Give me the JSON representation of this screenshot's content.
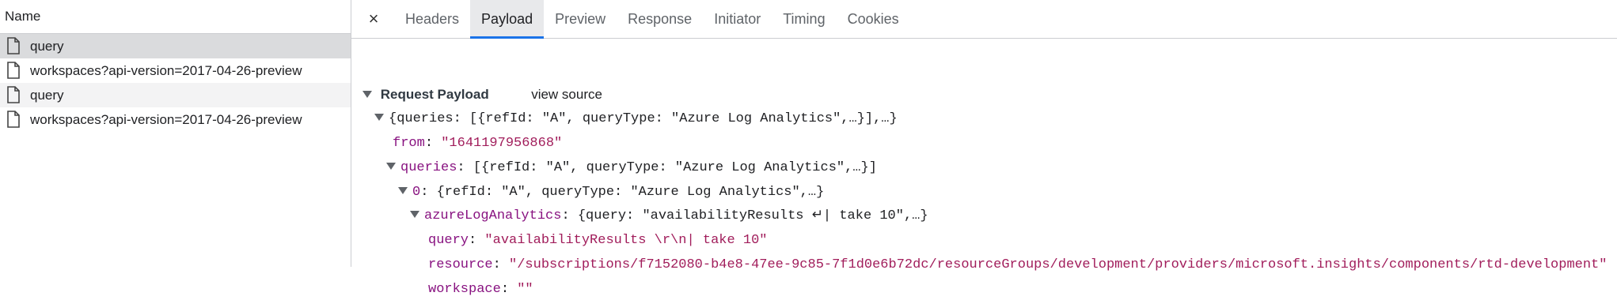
{
  "left_panel": {
    "header": "Name",
    "requests": [
      {
        "name": "query"
      },
      {
        "name": "workspaces?api-version=2017-04-26-preview"
      },
      {
        "name": "query"
      },
      {
        "name": "workspaces?api-version=2017-04-26-preview"
      }
    ]
  },
  "tabs": {
    "close_symbol": "×",
    "items": [
      "Headers",
      "Payload",
      "Preview",
      "Response",
      "Initiator",
      "Timing",
      "Cookies"
    ],
    "active": "Payload"
  },
  "payload": {
    "section_title": "Request Payload",
    "view_source": "view source",
    "root_summary": "{queries: [{refId: \"A\", queryType: \"Azure Log Analytics\",…}],…}",
    "from_key": "from",
    "from_value": "\"1641197956868\"",
    "queries_key": "queries",
    "queries_summary": "[{refId: \"A\", queryType: \"Azure Log Analytics\",…}]",
    "item0_key": "0",
    "item0_summary": "{refId: \"A\", queryType: \"Azure Log Analytics\",…}",
    "ala_key": "azureLogAnalytics",
    "ala_summary": "{query: \"availabilityResults ↵| take 10\",…}",
    "query_key": "query",
    "query_value": "\"availabilityResults \\r\\n| take 10\"",
    "resource_key": "resource",
    "resource_value": "\"/subscriptions/f7152080-b4e8-47ee-9c85-7f1d0e6b72dc/resourceGroups/development/providers/microsoft.insights/components/rtd-development\"",
    "workspace_key": "workspace",
    "workspace_value": "\"\""
  }
}
